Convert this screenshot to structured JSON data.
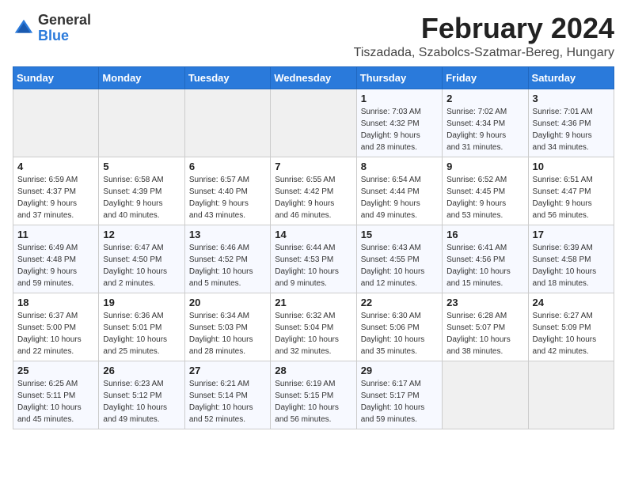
{
  "logo": {
    "general": "General",
    "blue": "Blue"
  },
  "header": {
    "title": "February 2024",
    "subtitle": "Tiszadada, Szabolcs-Szatmar-Bereg, Hungary"
  },
  "calendar": {
    "columns": [
      "Sunday",
      "Monday",
      "Tuesday",
      "Wednesday",
      "Thursday",
      "Friday",
      "Saturday"
    ],
    "weeks": [
      [
        {
          "day": "",
          "info": ""
        },
        {
          "day": "",
          "info": ""
        },
        {
          "day": "",
          "info": ""
        },
        {
          "day": "",
          "info": ""
        },
        {
          "day": "1",
          "info": "Sunrise: 7:03 AM\nSunset: 4:32 PM\nDaylight: 9 hours\nand 28 minutes."
        },
        {
          "day": "2",
          "info": "Sunrise: 7:02 AM\nSunset: 4:34 PM\nDaylight: 9 hours\nand 31 minutes."
        },
        {
          "day": "3",
          "info": "Sunrise: 7:01 AM\nSunset: 4:36 PM\nDaylight: 9 hours\nand 34 minutes."
        }
      ],
      [
        {
          "day": "4",
          "info": "Sunrise: 6:59 AM\nSunset: 4:37 PM\nDaylight: 9 hours\nand 37 minutes."
        },
        {
          "day": "5",
          "info": "Sunrise: 6:58 AM\nSunset: 4:39 PM\nDaylight: 9 hours\nand 40 minutes."
        },
        {
          "day": "6",
          "info": "Sunrise: 6:57 AM\nSunset: 4:40 PM\nDaylight: 9 hours\nand 43 minutes."
        },
        {
          "day": "7",
          "info": "Sunrise: 6:55 AM\nSunset: 4:42 PM\nDaylight: 9 hours\nand 46 minutes."
        },
        {
          "day": "8",
          "info": "Sunrise: 6:54 AM\nSunset: 4:44 PM\nDaylight: 9 hours\nand 49 minutes."
        },
        {
          "day": "9",
          "info": "Sunrise: 6:52 AM\nSunset: 4:45 PM\nDaylight: 9 hours\nand 53 minutes."
        },
        {
          "day": "10",
          "info": "Sunrise: 6:51 AM\nSunset: 4:47 PM\nDaylight: 9 hours\nand 56 minutes."
        }
      ],
      [
        {
          "day": "11",
          "info": "Sunrise: 6:49 AM\nSunset: 4:48 PM\nDaylight: 9 hours\nand 59 minutes."
        },
        {
          "day": "12",
          "info": "Sunrise: 6:47 AM\nSunset: 4:50 PM\nDaylight: 10 hours\nand 2 minutes."
        },
        {
          "day": "13",
          "info": "Sunrise: 6:46 AM\nSunset: 4:52 PM\nDaylight: 10 hours\nand 5 minutes."
        },
        {
          "day": "14",
          "info": "Sunrise: 6:44 AM\nSunset: 4:53 PM\nDaylight: 10 hours\nand 9 minutes."
        },
        {
          "day": "15",
          "info": "Sunrise: 6:43 AM\nSunset: 4:55 PM\nDaylight: 10 hours\nand 12 minutes."
        },
        {
          "day": "16",
          "info": "Sunrise: 6:41 AM\nSunset: 4:56 PM\nDaylight: 10 hours\nand 15 minutes."
        },
        {
          "day": "17",
          "info": "Sunrise: 6:39 AM\nSunset: 4:58 PM\nDaylight: 10 hours\nand 18 minutes."
        }
      ],
      [
        {
          "day": "18",
          "info": "Sunrise: 6:37 AM\nSunset: 5:00 PM\nDaylight: 10 hours\nand 22 minutes."
        },
        {
          "day": "19",
          "info": "Sunrise: 6:36 AM\nSunset: 5:01 PM\nDaylight: 10 hours\nand 25 minutes."
        },
        {
          "day": "20",
          "info": "Sunrise: 6:34 AM\nSunset: 5:03 PM\nDaylight: 10 hours\nand 28 minutes."
        },
        {
          "day": "21",
          "info": "Sunrise: 6:32 AM\nSunset: 5:04 PM\nDaylight: 10 hours\nand 32 minutes."
        },
        {
          "day": "22",
          "info": "Sunrise: 6:30 AM\nSunset: 5:06 PM\nDaylight: 10 hours\nand 35 minutes."
        },
        {
          "day": "23",
          "info": "Sunrise: 6:28 AM\nSunset: 5:07 PM\nDaylight: 10 hours\nand 38 minutes."
        },
        {
          "day": "24",
          "info": "Sunrise: 6:27 AM\nSunset: 5:09 PM\nDaylight: 10 hours\nand 42 minutes."
        }
      ],
      [
        {
          "day": "25",
          "info": "Sunrise: 6:25 AM\nSunset: 5:11 PM\nDaylight: 10 hours\nand 45 minutes."
        },
        {
          "day": "26",
          "info": "Sunrise: 6:23 AM\nSunset: 5:12 PM\nDaylight: 10 hours\nand 49 minutes."
        },
        {
          "day": "27",
          "info": "Sunrise: 6:21 AM\nSunset: 5:14 PM\nDaylight: 10 hours\nand 52 minutes."
        },
        {
          "day": "28",
          "info": "Sunrise: 6:19 AM\nSunset: 5:15 PM\nDaylight: 10 hours\nand 56 minutes."
        },
        {
          "day": "29",
          "info": "Sunrise: 6:17 AM\nSunset: 5:17 PM\nDaylight: 10 hours\nand 59 minutes."
        },
        {
          "day": "",
          "info": ""
        },
        {
          "day": "",
          "info": ""
        }
      ]
    ]
  }
}
